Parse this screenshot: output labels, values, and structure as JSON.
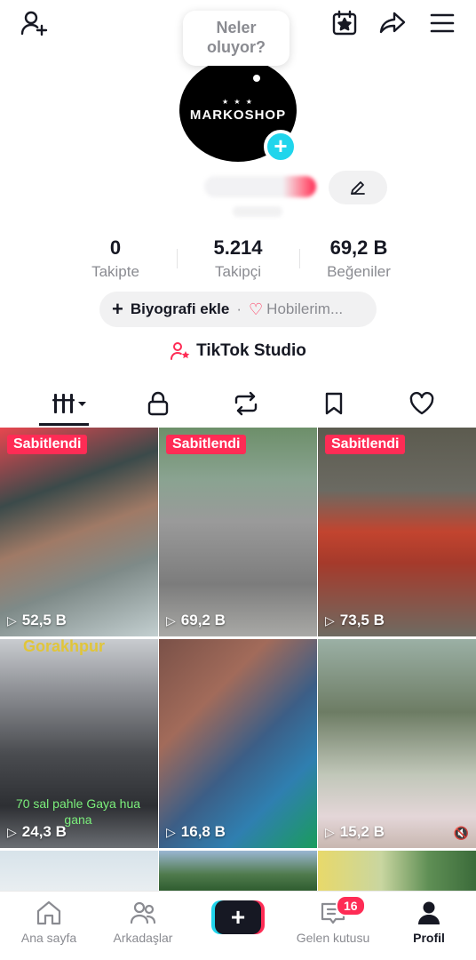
{
  "bubble": {
    "line1": "Neler",
    "line2": "oluyor?"
  },
  "avatar": {
    "brand": "MARKOSHOP",
    "stars": "★ ★ ★"
  },
  "stats": [
    {
      "value": "0",
      "label": "Takipte"
    },
    {
      "value": "5.214",
      "label": "Takipçi"
    },
    {
      "value": "69,2 B",
      "label": "Beğeniler"
    }
  ],
  "bio": {
    "add_label": "Biyografi ekle",
    "separator": "·",
    "hobby_label": "Hobilerim..."
  },
  "studio": {
    "label": "TikTok Studio"
  },
  "videos": [
    {
      "pinned": "Sabitlendi",
      "views": "52,5 B"
    },
    {
      "pinned": "Sabitlendi",
      "views": "69,2 B"
    },
    {
      "pinned": "Sabitlendi",
      "views": "73,5 B"
    },
    {
      "views": "24,3 B",
      "caption": "70 sal pahle Gaya hua gana",
      "top_caption": "Gorakhpur"
    },
    {
      "views": "16,8 B"
    },
    {
      "views": "15,2 B"
    }
  ],
  "nav": {
    "home": "Ana sayfa",
    "friends": "Arkadaşlar",
    "inbox": "Gelen kutusu",
    "inbox_badge": "16",
    "profile": "Profil"
  },
  "colors": {
    "accent": "#fe2c55",
    "cyan": "#20d5ec",
    "text": "#161823",
    "muted": "#8a8b91"
  }
}
